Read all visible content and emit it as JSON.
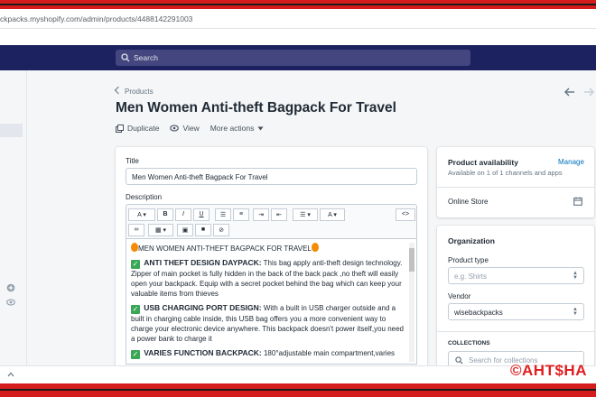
{
  "browser": {
    "url": "ckpacks.myshopify.com/admin/products/4488142291003"
  },
  "topbar": {
    "search_placeholder": "Search"
  },
  "header": {
    "breadcrumb": "Products",
    "title": "Men Women Anti-theft Bagpack For Travel",
    "actions": [
      "Duplicate",
      "View",
      "More actions"
    ]
  },
  "product_form": {
    "title_label": "Title",
    "title_value": "Men Women Anti-theft Bagpack For Travel",
    "description_label": "Description",
    "toolbar": {
      "font": "A",
      "bold": "B",
      "italic": "I",
      "underline": "U",
      "html": "<>"
    },
    "description": {
      "headline": "MEN WOMEN ANTI-THEFT BAGPACK FOR TRAVEL",
      "paragraphs": [
        {
          "heading": "ANTI THEFT DESIGN DAYPACK:",
          "text": "This bag apply anti-theft design technology. Zipper of main pocket is fully hidden in the back of the back pack ,no theft will easily open your backpack. Equip with a secret pocket behind the bag which can keep your valuable items from thieves"
        },
        {
          "heading": "USB CHARGING PORT DESIGN:",
          "text": "With a built in USB charger outside and a built in charging cable inside, this USB bag offers you a more convenient way to charge your electronic device anywhere. This backpack doesn't power itself,you need a power bank to charge it"
        },
        {
          "heading": "VARIES FUNCTION BACKPACK:",
          "text": "180°adjustable main compartment,varies"
        }
      ]
    }
  },
  "availability": {
    "title": "Product availability",
    "manage_label": "Manage",
    "subtitle": "Available on 1 of 1 channels and apps",
    "channel": "Online Store"
  },
  "organization": {
    "title": "Organization",
    "product_type_label": "Product type",
    "product_type_placeholder": "e.g. Shirts",
    "vendor_label": "Vendor",
    "vendor_value": "wisebackpacks",
    "collections_label": "COLLECTIONS",
    "collections_placeholder": "Search for collections"
  },
  "watermark": "©AHT$HA",
  "colors": {
    "nav": "#1c2260",
    "accent_link": "#006fbb",
    "frame_red": "#d41c1c",
    "check_green": "#3aa757"
  }
}
